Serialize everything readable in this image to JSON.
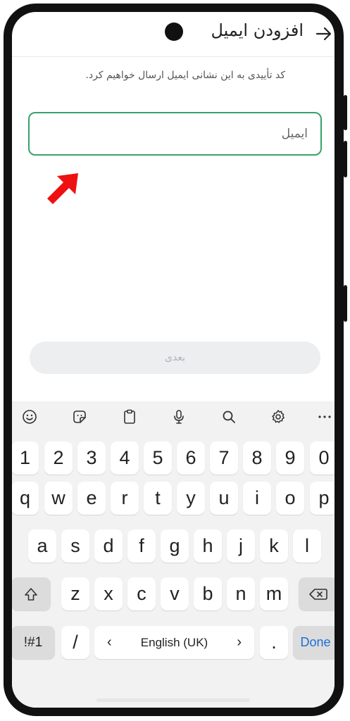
{
  "header": {
    "title": "افزودن ایمیل",
    "back_icon": "arrow-right-icon"
  },
  "description": "کد تأییدی به این نشانی ایمیل ارسال خواهیم کرد.",
  "email_field": {
    "placeholder": "ایمیل",
    "value": "",
    "border_color": "#35a36a"
  },
  "next_button": {
    "label": "بعدی"
  },
  "annotation": {
    "arrow_color": "#ee1111"
  },
  "keyboard": {
    "toolbar": [
      "emoji-icon",
      "sticker-icon",
      "clipboard-icon",
      "microphone-icon",
      "search-icon",
      "gear-icon",
      "more-icon"
    ],
    "number_row": [
      "1",
      "2",
      "3",
      "4",
      "5",
      "6",
      "7",
      "8",
      "9",
      "0"
    ],
    "row1": [
      "q",
      "w",
      "e",
      "r",
      "t",
      "y",
      "u",
      "i",
      "o",
      "p"
    ],
    "row2": [
      "a",
      "s",
      "d",
      "f",
      "g",
      "h",
      "j",
      "k",
      "l"
    ],
    "row3": [
      "z",
      "x",
      "c",
      "v",
      "b",
      "n",
      "m"
    ],
    "symbols_key": "!#1",
    "slash_key": "/",
    "space_label": "English (UK)",
    "space_left": "‹",
    "space_right": "›",
    "period_key": ".",
    "done_key": "Done"
  }
}
